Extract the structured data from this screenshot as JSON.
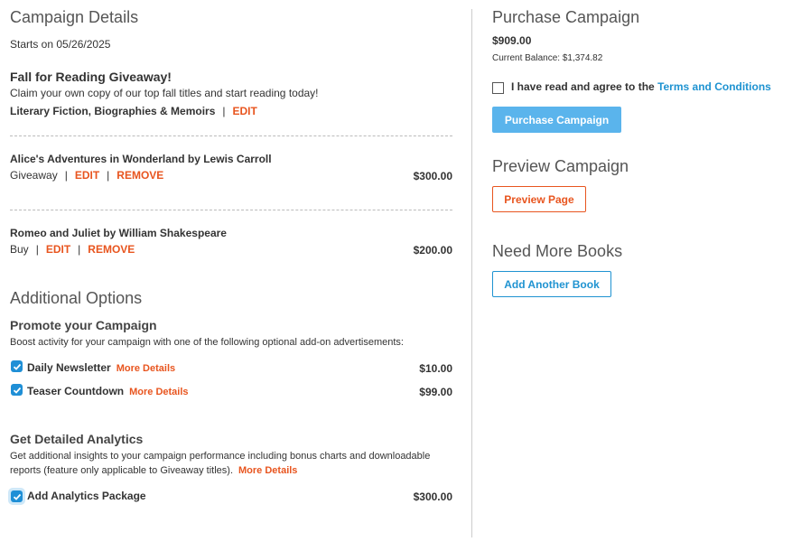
{
  "campaign": {
    "title": "Campaign Details",
    "starts": "Starts on 05/26/2025",
    "name": "Fall for Reading Giveaway!",
    "description": "Claim your own copy of our top fall titles and start reading today!",
    "genres": "Literary Fiction, Biographies & Memoirs",
    "edit_label": "EDIT"
  },
  "books": [
    {
      "title": "Alice's Adventures in Wonderland by Lewis Carroll",
      "type": "Giveaway",
      "edit": "EDIT",
      "remove": "REMOVE",
      "price": "$300.00"
    },
    {
      "title": "Romeo and Juliet by William Shakespeare",
      "type": "Buy",
      "edit": "EDIT",
      "remove": "REMOVE",
      "price": "$200.00"
    }
  ],
  "additional": {
    "title": "Additional Options",
    "promote_title": "Promote your Campaign",
    "promote_desc": "Boost activity for your campaign with one of the following optional add-on advertisements:",
    "options": [
      {
        "label": "Daily Newsletter",
        "more": "More Details",
        "price": "$10.00",
        "checked": true
      },
      {
        "label": "Teaser Countdown",
        "more": "More Details",
        "price": "$99.00",
        "checked": true
      }
    ],
    "analytics_title": "Get Detailed Analytics",
    "analytics_desc_1": "Get additional insights to your campaign performance including bonus charts and downloadable",
    "analytics_desc_2": "reports (feature only applicable to Giveaway titles).",
    "analytics_more": "More Details",
    "analytics_label": "Add Analytics Package",
    "analytics_price": "$300.00",
    "analytics_checked": true
  },
  "purchase": {
    "title": "Purchase Campaign",
    "total": "$909.00",
    "balance": "Current Balance: $1,374.82",
    "agree_text": "I have read and agree to the",
    "terms_link": "Terms and Conditions",
    "agree_checked": false,
    "button": "Purchase Campaign"
  },
  "preview": {
    "title": "Preview Campaign",
    "button": "Preview Page"
  },
  "more_books": {
    "title": "Need More Books",
    "button": "Add Another Book"
  },
  "colors": {
    "accent_orange": "#e8551f",
    "accent_blue": "#1f93d1",
    "button_blue": "#5ab4ec"
  }
}
